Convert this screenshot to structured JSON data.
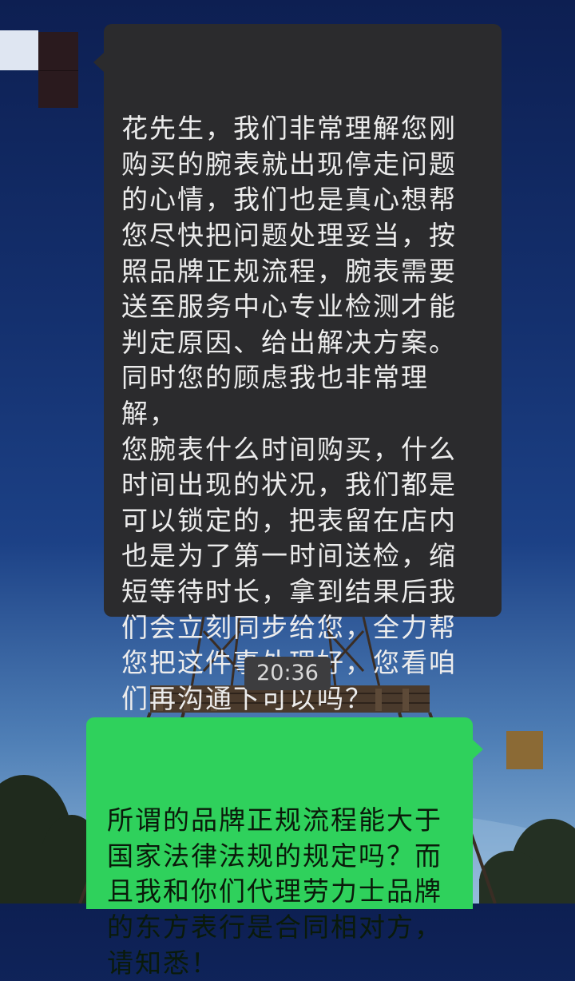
{
  "conversation": {
    "incoming_message": "花先生，我们非常理解您刚\n购买的腕表就出现停走问题\n的心情，我们也是真心想帮\n您尽快把问题处理妥当，按\n照品牌正规流程，腕表需要\n送至服务中心专业检测才能\n判定原因、给出解决方案。\n同时您的顾虑我也非常理解，\n您腕表什么时间购买，什么\n时间出现的状况，我们都是\n可以锁定的，把表留在店内\n也是为了第一时间送检，缩\n短等待时长，拿到结果后我\n们会立刻同步给您，全力帮\n您把这件事处理好，您看咱\n们再沟通下可以吗？",
    "timestamp": "20:36",
    "outgoing_message": "所谓的品牌正规流程能大于\n国家法律法规的规定吗？而\n且我和你们代理劳力士品牌\n的东方表行是合同相对方，\n请知悉！"
  },
  "colors": {
    "incoming_bubble": "#2b2b2d",
    "outgoing_bubble": "#2fd15c",
    "timestamp_badge": "#3d3d3f"
  },
  "icons": {
    "background": "eiffel-tower-background",
    "contact_avatar": "contact-avatar",
    "user_avatar": "user-avatar"
  }
}
